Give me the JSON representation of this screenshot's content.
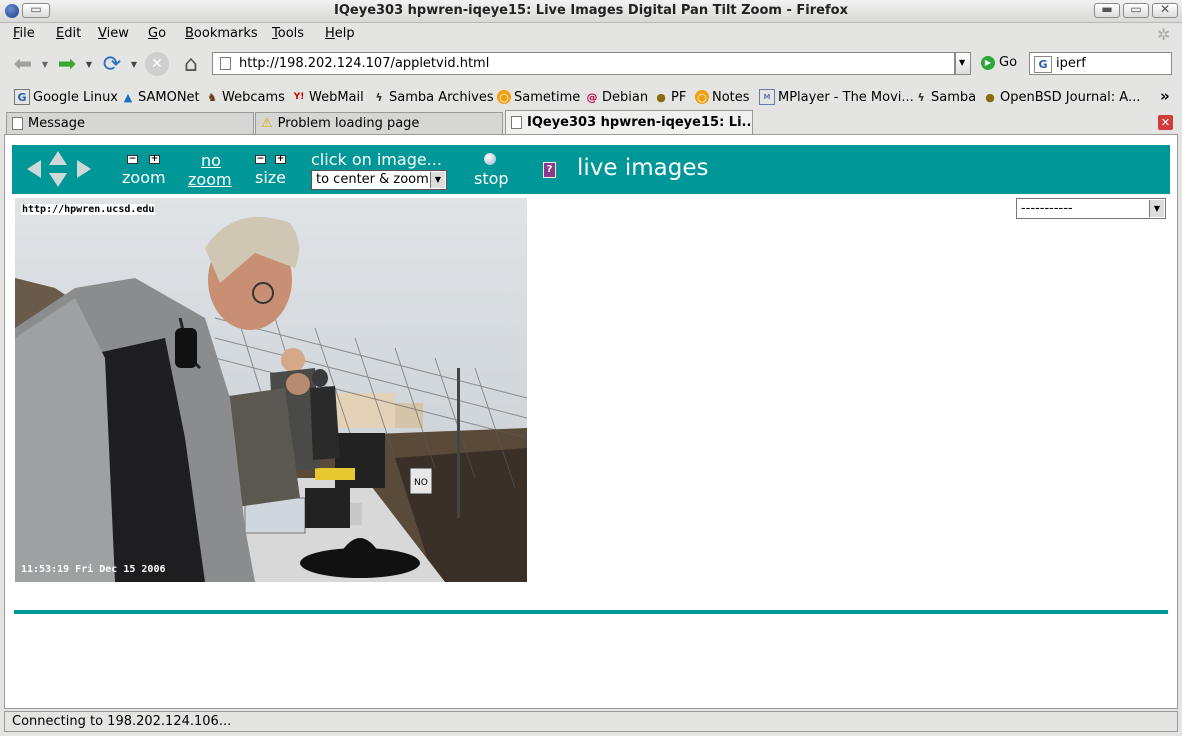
{
  "window": {
    "title": "IQeye303 hpwren-iqeye15: Live Images Digital Pan Tilt Zoom - Firefox"
  },
  "menu": {
    "items": [
      {
        "u": "F",
        "rest": "ile"
      },
      {
        "u": "E",
        "rest": "dit"
      },
      {
        "u": "V",
        "rest": "iew"
      },
      {
        "u": "G",
        "rest": "o"
      },
      {
        "u": "B",
        "rest": "ookmarks"
      },
      {
        "u": "T",
        "rest": "ools"
      },
      {
        "u": "H",
        "rest": "elp"
      }
    ]
  },
  "toolbar": {
    "url": "http://198.202.124.107/appletvid.html",
    "go_label": "Go",
    "search_value": "iperf"
  },
  "bookmarks": {
    "items": [
      {
        "label": "Google Linux",
        "icon": "google-icon"
      },
      {
        "label": "SAMONet",
        "icon": "samonet-icon"
      },
      {
        "label": "Webcams",
        "icon": "webcams-icon"
      },
      {
        "label": "WebMail",
        "icon": "yahoo-icon"
      },
      {
        "label": "Samba Archives",
        "icon": "samba-icon"
      },
      {
        "label": "Sametime",
        "icon": "sametime-icon"
      },
      {
        "label": "Debian",
        "icon": "debian-icon"
      },
      {
        "label": "PF",
        "icon": "pufferfish-icon"
      },
      {
        "label": "Notes",
        "icon": "notes-icon"
      },
      {
        "label": "MPlayer - The Movi...",
        "icon": "mplayer-icon"
      },
      {
        "label": "Samba",
        "icon": "samba-icon"
      },
      {
        "label": "OpenBSD Journal: A...",
        "icon": "pufferfish-icon"
      }
    ],
    "overflow": "»"
  },
  "tabs": [
    {
      "label": "Message",
      "active": false
    },
    {
      "label": "Problem loading page",
      "active": false
    },
    {
      "label": "IQeye303 hpwren-iqeye15: Li...",
      "active": true
    }
  ],
  "ptz": {
    "zoom_label": "zoom",
    "no_label": "no",
    "nozoom_label": "zoom",
    "size_label": "size",
    "click_label": "click on image...",
    "select_value": "to center & zoom",
    "stop_label": "stop",
    "help_label": "?",
    "live_label": "live images"
  },
  "camera": {
    "overlay_url": "http://hpwren.ucsd.edu",
    "timestamp": "11:53:19 Fri Dec 15 2006",
    "sign_text": "NO"
  },
  "right_select": {
    "value": "-----------"
  },
  "status": {
    "text": "Connecting to 198.202.124.106..."
  },
  "colors": {
    "teal": "#009799"
  }
}
